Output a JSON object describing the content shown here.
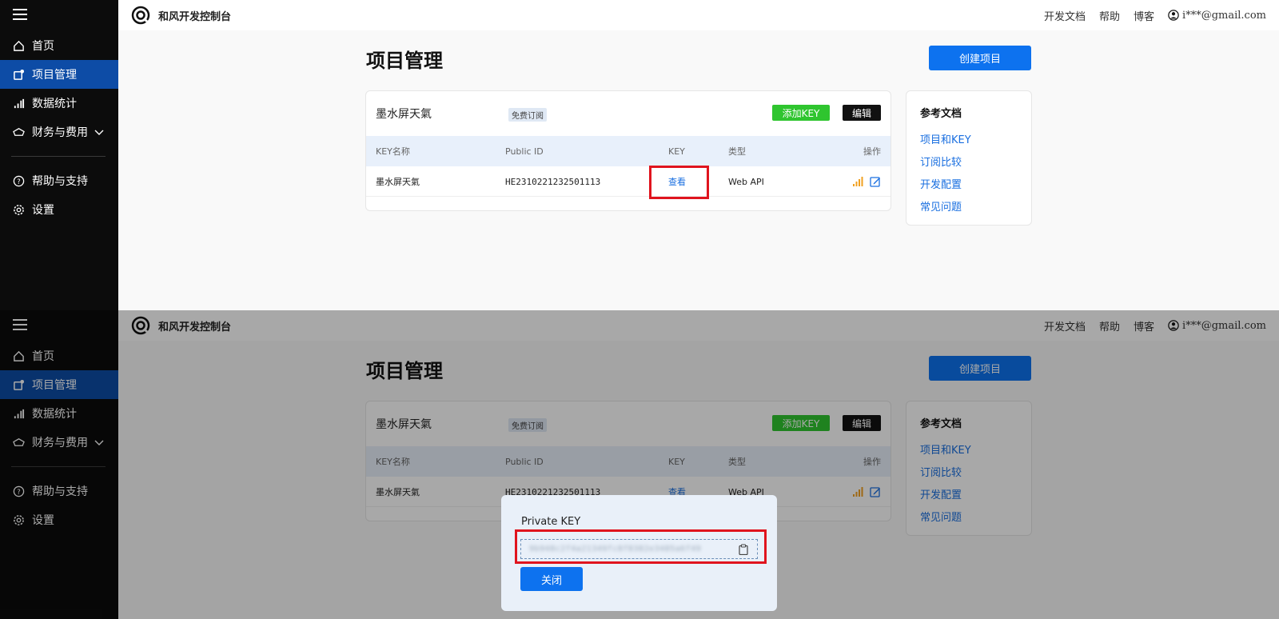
{
  "sidebar": {
    "items": [
      {
        "label": "首页",
        "icon": "home-icon"
      },
      {
        "label": "项目管理",
        "icon": "project-icon",
        "active": true
      },
      {
        "label": "数据统计",
        "icon": "bar-chart-icon"
      },
      {
        "label": "财务与费用",
        "icon": "finance-icon",
        "expandable": true
      },
      {
        "label": "帮助与支持",
        "icon": "help-icon"
      },
      {
        "label": "设置",
        "icon": "gear-icon"
      }
    ]
  },
  "header": {
    "brand": "和风开发控制台",
    "links": [
      "开发文档",
      "帮助",
      "博客"
    ],
    "user": "i***@gmail.com"
  },
  "main": {
    "title": "项目管理",
    "create_button": "创建项目"
  },
  "project": {
    "name": "墨水屏天氣",
    "tag": "免费订阅",
    "add_key_button": "添加KEY",
    "edit_button": "编辑",
    "columns": [
      "KEY名称",
      "Public ID",
      "KEY",
      "类型",
      "操作"
    ],
    "rows": [
      {
        "name": "墨水屏天氣",
        "public_id": "HE2310221232501113",
        "key": "查看",
        "type": "Web API"
      }
    ]
  },
  "reference": {
    "title": "参考文档",
    "links": [
      "项目和KEY",
      "订阅比较",
      "开发配置",
      "常见问题"
    ]
  },
  "dialog": {
    "title": "Private KEY",
    "key_value": "9b948c2f4a21349fc8f8382e3485a6f49",
    "close_button": "关闭"
  },
  "colors": {
    "accent": "#0d72ef",
    "sidebar_bg": "#0c0c0c",
    "sidebar_active": "#0d4ca6",
    "add_key_green": "#2fc52f",
    "highlight_red": "#e0141e"
  }
}
